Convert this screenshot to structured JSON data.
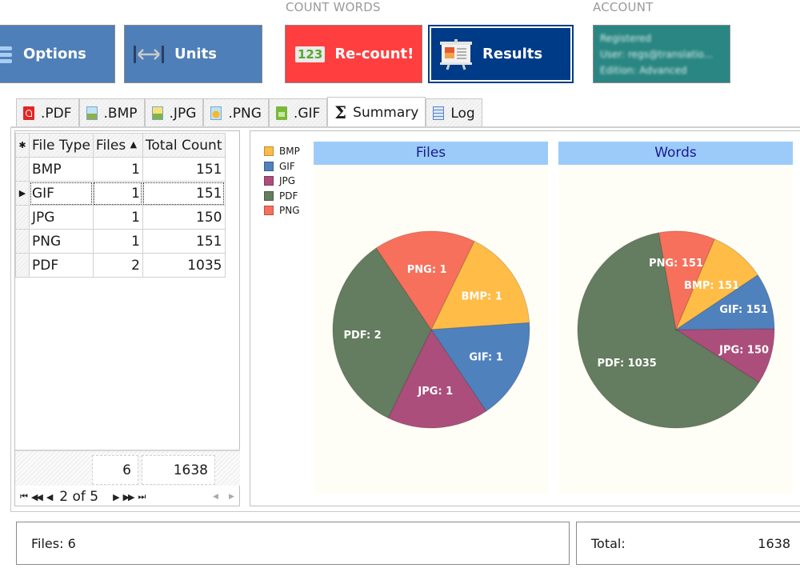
{
  "ribbon": {
    "groups": {
      "count_words": "COUNT WORDS",
      "account": "ACCOUNT"
    },
    "buttons": {
      "options": "Options",
      "units": "Units",
      "recount": "Re-count!",
      "results": "Results",
      "recount_icon_text": "123"
    },
    "account": {
      "line1": "Registered",
      "line2": "User: regs@translatio...",
      "line3": "Edition: Advanced"
    }
  },
  "tabs": [
    {
      "label": ".PDF",
      "icon": "pdf-file-icon"
    },
    {
      "label": ".BMP",
      "icon": "bmp-image-icon"
    },
    {
      "label": ".JPG",
      "icon": "jpg-image-icon"
    },
    {
      "label": ".PNG",
      "icon": "png-image-icon"
    },
    {
      "label": ".GIF",
      "icon": "gif-image-icon"
    },
    {
      "label": "Summary",
      "icon": "sigma-icon",
      "active": true
    },
    {
      "label": "Log",
      "icon": "log-document-icon"
    }
  ],
  "grid": {
    "columns": [
      "File Type",
      "Files",
      "Total Count"
    ],
    "sort_column": "Files",
    "sort_dir": "ascending",
    "rows": [
      {
        "type": "BMP",
        "files": "1",
        "count": "151"
      },
      {
        "type": "GIF",
        "files": "1",
        "count": "151",
        "selected": true
      },
      {
        "type": "JPG",
        "files": "1",
        "count": "150"
      },
      {
        "type": "PNG",
        "files": "1",
        "count": "151"
      },
      {
        "type": "PDF",
        "files": "2",
        "count": "1035"
      }
    ],
    "footer": {
      "files_total": "6",
      "count_total": "1638"
    },
    "pager": {
      "text": "2 of 5"
    }
  },
  "chart_data": [
    {
      "type": "pie",
      "title": "Files",
      "categories": [
        "BMP",
        "GIF",
        "JPG",
        "PDF",
        "PNG"
      ],
      "values": [
        1,
        1,
        1,
        2,
        1
      ],
      "labels": [
        "BMP: 1",
        "GIF: 1",
        "JPG: 1",
        "PDF: 2",
        "PNG: 1"
      ],
      "legend": "left"
    },
    {
      "type": "pie",
      "title": "Words",
      "categories": [
        "BMP",
        "GIF",
        "JPG",
        "PDF",
        "PNG"
      ],
      "values": [
        151,
        151,
        150,
        1035,
        151
      ],
      "labels": [
        "BMP: 151",
        "GIF: 151",
        "JPG: 150",
        "PDF: 1035",
        "PNG: 151"
      ],
      "legend": "left"
    }
  ],
  "legend": [
    {
      "label": "BMP",
      "color": "#ffbc47"
    },
    {
      "label": "GIF",
      "color": "#4f81bd"
    },
    {
      "label": "JPG",
      "color": "#ab4e7b"
    },
    {
      "label": "PDF",
      "color": "#647c5f"
    },
    {
      "label": "PNG",
      "color": "#f6705b"
    }
  ],
  "status": {
    "files": "Files: 6",
    "total_label": "Total:",
    "total_value": "1638"
  }
}
